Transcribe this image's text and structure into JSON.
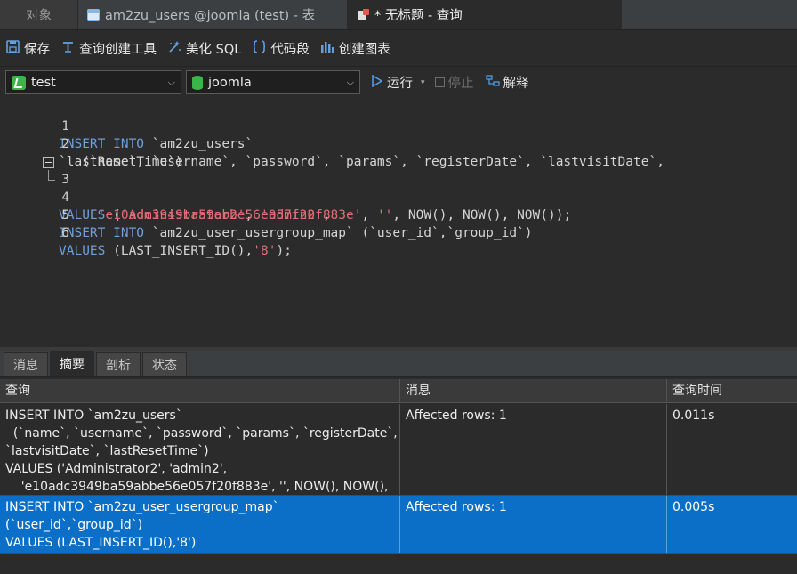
{
  "tabs": {
    "objects": "对象",
    "table_tab": "am2zu_users @joomla (test) - 表",
    "query_tab": "* 无标题 - 查询"
  },
  "toolbar": {
    "save": "保存",
    "query_builder": "查询创建工具",
    "beautify": "美化 SQL",
    "snippet": "代码段",
    "create_chart": "创建图表"
  },
  "toolbar2": {
    "connection": "test",
    "database": "joomla",
    "run": "运行",
    "stop": "停止",
    "explain": "解释"
  },
  "editor": {
    "line_numbers": [
      "1",
      "2",
      "",
      "3",
      "4",
      "5",
      "6"
    ]
  },
  "bottom_tabs": [
    "消息",
    "摘要",
    "剖析",
    "状态"
  ],
  "results": {
    "columns": [
      "查询",
      "消息",
      "查询时间"
    ],
    "rows": [
      {
        "query": "INSERT INTO `am2zu_users`\n  (`name`, `username`, `password`, `params`, `registerDate`,\n`lastvisitDate`, `lastResetTime`)\nVALUES ('Administrator2', 'admin2',\n    'e10adc3949ba59abbe56e057f20f883e', '', NOW(), NOW(),",
        "message": "Affected rows: 1",
        "time": "0.011s"
      },
      {
        "query": "INSERT INTO `am2zu_user_usergroup_map`\n(`user_id`,`group_id`)\nVALUES (LAST_INSERT_ID(),'8')",
        "message": "Affected rows: 1",
        "time": "0.005s"
      }
    ]
  },
  "colors": {
    "keyword": "#6f9fd8",
    "string": "#e06c75",
    "selection": "#0c6fc7",
    "background": "#2b2b2b"
  },
  "icons": [
    "table-icon",
    "query-icon",
    "save-icon",
    "query-builder-icon",
    "beautify-icon",
    "snippet-icon",
    "chart-icon",
    "connection-icon",
    "database-icon",
    "run-icon",
    "stop-icon",
    "explain-icon"
  ]
}
